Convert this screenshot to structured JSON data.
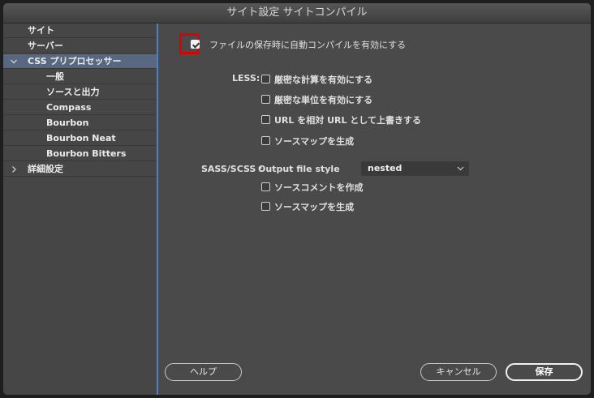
{
  "window": {
    "title": "サイト設定 サイトコンパイル"
  },
  "sidebar": {
    "items": [
      {
        "label": "サイト"
      },
      {
        "label": "サーバー"
      },
      {
        "label": "CSS プリプロセッサー"
      },
      {
        "label": "一般"
      },
      {
        "label": "ソースと出力"
      },
      {
        "label": "Compass"
      },
      {
        "label": "Bourbon"
      },
      {
        "label": "Bourbon Neat"
      },
      {
        "label": "Bourbon Bitters"
      },
      {
        "label": "詳細設定"
      }
    ]
  },
  "main": {
    "autocompile_label": "ファイルの保存時に自動コンパイルを有効にする",
    "autocompile_checked": true,
    "less": {
      "label": "LESS:",
      "options": [
        {
          "label": "厳密な計算を有効にする",
          "checked": false
        },
        {
          "label": "厳密な単位を有効にする",
          "checked": false
        },
        {
          "label": "URL を相対 URL として上書きする",
          "checked": false
        },
        {
          "label": "ソースマップを生成",
          "checked": false
        }
      ]
    },
    "sass": {
      "label": "SASS/SCSS :",
      "style_label": "Output file style",
      "style_value": "nested",
      "options": [
        {
          "label": "ソースコメントを作成",
          "checked": false
        },
        {
          "label": "ソースマップを生成",
          "checked": false
        }
      ]
    }
  },
  "footer": {
    "help": "ヘルプ",
    "cancel": "キャンセル",
    "save": "保存"
  },
  "colors": {
    "accent": "#4e7fc2",
    "selection": "#586880",
    "highlight": "#e00000"
  }
}
